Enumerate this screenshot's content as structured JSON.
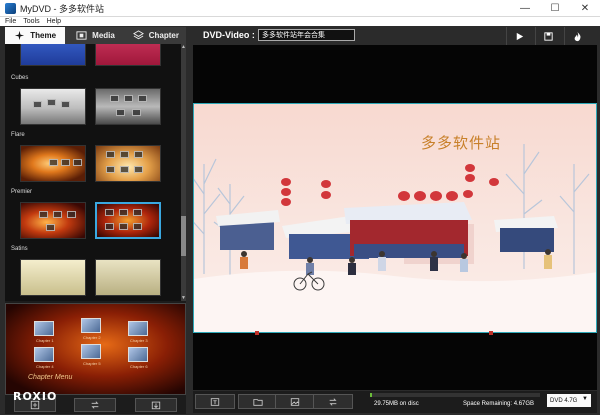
{
  "window": {
    "title": "MyDVD - 多多软件站",
    "controls": [
      "—",
      "☐",
      "✕"
    ]
  },
  "menu": [
    "File",
    "Tools",
    "Help"
  ],
  "tabs": [
    {
      "label": "Theme",
      "icon": "theme-icon",
      "active": true
    },
    {
      "label": "Media",
      "icon": "film-icon",
      "active": false
    },
    {
      "label": "Chapter",
      "icon": "layers-icon",
      "active": false
    }
  ],
  "themes": {
    "categories": [
      "Cubes",
      "Flare",
      "Premier",
      "Satins"
    ]
  },
  "preview_small": {
    "chapter_menu_label": "Chapter Menu",
    "chapter_labels": [
      "Chapter 1",
      "Chapter 2",
      "Chapter 3",
      "Chapter 4",
      "Chapter 5",
      "Chapter 6"
    ]
  },
  "brand": {
    "logo": "ROXIO"
  },
  "project": {
    "type_label": "DVD-Video :",
    "name": "多多软件站年会合集"
  },
  "canvas": {
    "title": "多多软件站"
  },
  "status": {
    "used": "29.75MB on disc",
    "remaining": "Space Remaining: 4.67GB",
    "usage_fraction": 0.006,
    "disc_type": "DVD 4.7G"
  },
  "colors": {
    "accent": "#2ea9b8",
    "selection": "#3aa8e0",
    "progress": "#6bbd3a",
    "title_gold": "#c8802a"
  }
}
